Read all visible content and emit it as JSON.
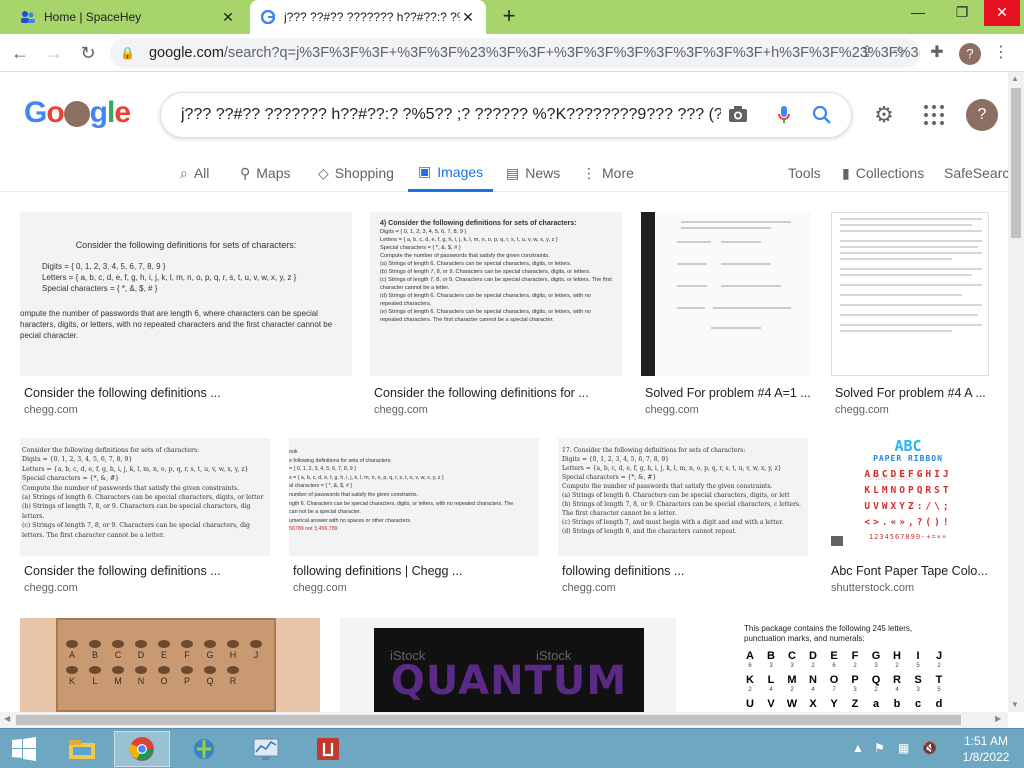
{
  "browser": {
    "tabs": [
      {
        "title": "Home | SpaceHey",
        "active": false
      },
      {
        "title": "j??? ??#?? ??????? h??#??:? ?%5?!",
        "active": true
      }
    ],
    "new_tab_label": "+",
    "window_controls": {
      "minimize": "—",
      "restore": "❐",
      "close": "✕"
    },
    "url_host": "google.com",
    "url_path": "/search?q=j%3F%3F%3F+%3F%3F%23%3F%3F+%3F%3F%3F%3F%3F%3F%3F+h%3F%3F%23%3F%3F%3..."
  },
  "google": {
    "logo_text": "Google",
    "query": "j??? ??#?? ??????? h??#??:? ?%5?? ;? ?????? %?K????????9??? ??? (??",
    "profile_initial": "?",
    "nav": [
      {
        "label": "All",
        "icon": "search-icon"
      },
      {
        "label": "Maps",
        "icon": "pin-icon"
      },
      {
        "label": "Shopping",
        "icon": "tag-icon"
      },
      {
        "label": "Images",
        "icon": "image-icon"
      },
      {
        "label": "News",
        "icon": "news-icon"
      },
      {
        "label": "More",
        "icon": "more-icon"
      }
    ],
    "tools_label": "Tools",
    "collections_label": "Collections",
    "safesearch_label": "SafeSearch"
  },
  "results": {
    "row1": [
      {
        "caption": "Consider the following definitions ...",
        "source": "chegg.com",
        "doc_title": "Consider the following definitions for sets of characters:",
        "doc_lines": [
          "Digits = { 0, 1, 2, 3, 4, 5, 6, 7, 8, 9 }",
          "Letters = { a, b, c, d, e, f, g, h, i, j, k, l, m, n, o, p, q, r, s, t, u, v, w, x, y, z }",
          "Special characters = { *, &, $, # }",
          "ompute the number of passwords that are length 6, where characters can be special",
          "haracters, digits, or letters, with no repeated characters and the first character cannot be",
          "pecial character."
        ]
      },
      {
        "caption": "Consider the following definitions for ...",
        "source": "chegg.com",
        "doc_title": "4) Consider the following definitions for sets of characters:",
        "doc_lines": [
          "Digits = { 0, 1, 2, 3, 4, 5, 6, 7, 8, 9 }",
          "Letters = { a, b, c, d, e, f, g, h, i, j, k, l, m, n, o, p, q, r, s, t, u, v, w, x, y, z }",
          "Special characters = { *, &, $, # }",
          "Compute the number of passwords that satisfy the given constraints.",
          "(a) Strings of length 6. Characters can be special characters, digits, or letters.",
          "(b) Strings of length 7, 8, or 9. Characters can be special characters, digits, or letters.",
          "(c) Strings of length 7, 8, or 9. Characters can be special characters, digits, or letters. The first character cannot be a letter.",
          "(d) Strings of length 6. Characters can be special characters, digits, or letters, with no repeated characters.",
          "(e) Strings of length 6. Characters can be special characters, digits, or letters, with no repeated characters. The first character cannot be a special character."
        ]
      },
      {
        "caption": "Solved For problem #4 A=1 ...",
        "source": "chegg.com"
      },
      {
        "caption": "Solved For problem #4 A ...",
        "source": "chegg.com"
      }
    ],
    "row2": [
      {
        "caption": "Consider the following definitions ...",
        "source": "chegg.com",
        "doc_lines": [
          "Consider the following definitions for sets of characters:",
          "Digits = {0, 1, 2, 3, 4, 5, 6, 7, 8, 9}",
          "Letters = {a, b, c, d, e, f, g, h, i, j, k, l, m, n, o, p, q, r, s, t, u, v, w, x, y, z}",
          "Special characters = {*, &, #}",
          "Compute the number of passwords that satisfy the given constraints.",
          "(a) Strings of length 6. Characters can be special characters, digits, or letter",
          "(b) Strings of length 7, 8, or 9.  Characters can be special characters, dig letters.",
          "(c) Strings of length 7, 8, or 9.  Characters can be special characters, dig letters. The first character cannot be a letter."
        ]
      },
      {
        "caption": "following definitions | Chegg ...",
        "source": "chegg.com",
        "doc_lines": [
          "ook",
          "e following definitions for sets of characters:",
          "= { 0, 1, 2, 3, 4, 5, 6, 7, 8, 9 }",
          "s = { a, b, c, d, e, f, g, h, i, j, k, l, m, n, o, p, q, r, s, t, u, v, w, x, y, z }",
          "al characters = { *, &, $, # }",
          "number of passwords that satisfy the given constraints.",
          "ngth 6. Characters can be special characters, digits, or letters, with no repeated characters. The",
          "can not be a special character.",
          "umerical answer with no spaces or other characters.",
          "56789 not 3,456,789"
        ]
      },
      {
        "caption": "following definitions ...",
        "source": "chegg.com",
        "doc_lines": [
          "17. Consider the following definitions for sets of characters:",
          "Digits = {0, 1, 2, 3, 4, 5, 6, 7, 8, 9}",
          "Letters = {a, b, c, d, e, f, g, h, i, j, k, l, m, n, o, p, q, r, s, t, u, v, w, x, y, z}",
          "Special characters = {*, &, #}",
          "Compute the number of passwords that satisfy the given constraints.",
          "(a) Strings of length 6. Characters can be special characters, digits, or lett",
          "(b) Strings of length 7, 8, or 9.  Characters can be special characters, c letters. The first character cannot be a letter.",
          "(c) Strings of length 7, and must begin with a digit and end with a letter.",
          "(d) Strings of length 6, and the characters cannot repeat."
        ]
      },
      {
        "caption": "Abc Font Paper Tape Colo...",
        "source": "shutterstock.com",
        "tape_title_1": "ABC",
        "tape_title_2": "PAPER RIBBON",
        "tape_rows": [
          "ABCDEFGHIJ",
          "KLMNOPQRST",
          "UVWXYZ:/\\;",
          "<>.«»,?()!",
          "1234567890-+=×÷"
        ],
        "watermark": "shutterstock"
      }
    ],
    "row3": [
      {
        "keyboard_letters": [
          "A",
          "B",
          "C",
          "D",
          "E",
          "F",
          "G",
          "H",
          "J",
          "K",
          "L",
          "M",
          "N",
          "O",
          "P",
          "Q",
          "R"
        ]
      },
      {
        "title_text": "QUANTUM",
        "watermark": "iStock"
      },
      {
        "header": "This package contains the following 245 letters, punctuation marks, and numerals:",
        "letters_row1": [
          "A",
          "B",
          "C",
          "D",
          "E",
          "F",
          "G",
          "H",
          "I",
          "J"
        ],
        "counts_row1": [
          "6",
          "3",
          "3",
          "2",
          "6",
          "2",
          "3",
          "2",
          "5",
          "2"
        ],
        "letters_row2": [
          "K",
          "L",
          "M",
          "N",
          "O",
          "P",
          "Q",
          "R",
          "S",
          "T"
        ],
        "counts_row2": [
          "2",
          "4",
          "2",
          "4",
          "7",
          "3",
          "2",
          "4",
          "3",
          "5"
        ],
        "letters_row3": [
          "U",
          "V",
          "W",
          "X",
          "Y",
          "Z",
          "a",
          "b",
          "c",
          "d"
        ]
      }
    ]
  },
  "taskbar": {
    "time": "1:51 AM",
    "date": "1/8/2022"
  },
  "colors": {
    "tabstrip": "#a7d56b",
    "accent": "#1a73e8",
    "taskbar": "#6ea7c2"
  }
}
